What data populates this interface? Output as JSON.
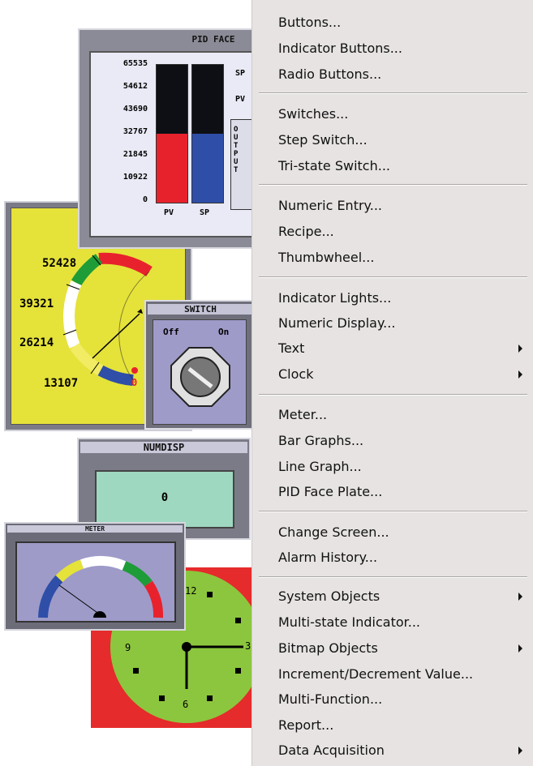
{
  "pid": {
    "title": "PID FACE",
    "scale": [
      "65535",
      "54612",
      "43690",
      "32767",
      "21845",
      "10922",
      "0"
    ],
    "bar_labels": [
      "PV",
      "SP"
    ],
    "side_labels": [
      "SP",
      "PV"
    ],
    "output_label": "OUTPUT",
    "pv_level": 0.5,
    "sp_level": 0.5
  },
  "meter_large": {
    "labels": [
      "52428",
      "39321",
      "26214",
      "13107",
      "0"
    ]
  },
  "switch": {
    "title": "SWITCH",
    "off": "Off",
    "on": "On"
  },
  "numdisp": {
    "title": "NUMDISP",
    "value": "0"
  },
  "meter_small": {
    "title": "METER"
  },
  "clock": {
    "labels": [
      "12",
      "3",
      "6",
      "9"
    ]
  },
  "colors": {
    "red": "#e8222d",
    "blue": "#2f4ea8",
    "yellow_panel": "#e5e23a",
    "green_clock": "#8cc63e",
    "clock_bg": "#e52b2b"
  },
  "menu": {
    "items": [
      {
        "label": "Buttons..."
      },
      {
        "label": "Indicator Buttons..."
      },
      {
        "label": "Radio Buttons..."
      },
      {
        "label": "Switches..."
      },
      {
        "label": "Step Switch..."
      },
      {
        "label": "Tri-state Switch..."
      },
      {
        "label": "Numeric Entry..."
      },
      {
        "label": "Recipe..."
      },
      {
        "label": "Thumbwheel..."
      },
      {
        "label": "Indicator Lights..."
      },
      {
        "label": "Numeric Display..."
      },
      {
        "label": "Text",
        "submenu": true
      },
      {
        "label": "Clock",
        "submenu": true
      },
      {
        "label": "Meter..."
      },
      {
        "label": "Bar Graphs..."
      },
      {
        "label": "Line Graph..."
      },
      {
        "label": "PID Face Plate..."
      },
      {
        "label": "Change Screen..."
      },
      {
        "label": "Alarm History..."
      },
      {
        "label": "System Objects",
        "submenu": true
      },
      {
        "label": "Multi-state Indicator..."
      },
      {
        "label": "Bitmap Objects",
        "submenu": true
      },
      {
        "label": "Increment/Decrement Value..."
      },
      {
        "label": "Multi-Function..."
      },
      {
        "label": "Report..."
      },
      {
        "label": "Data Acquisition",
        "submenu": true
      }
    ]
  }
}
